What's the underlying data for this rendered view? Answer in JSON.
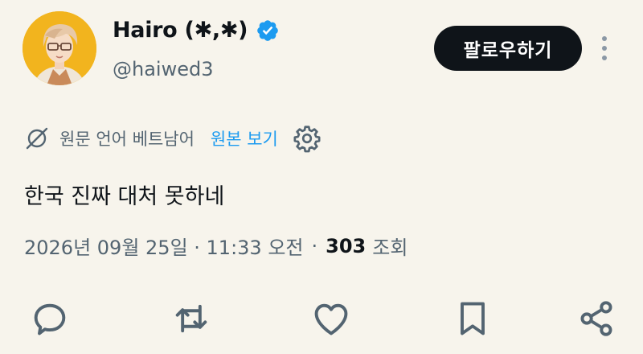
{
  "user": {
    "name": "Hairo (✱,✱)",
    "handle": "@haiwed3"
  },
  "follow_label": "팔로우하기",
  "translation": {
    "source_text": "원문 언어 베트남어",
    "show_original": "원본 보기"
  },
  "tweet": {
    "text": "한국 진짜 대처 못하네",
    "datetime": "2026년 09월 25일 · 11:33 오전",
    "views_count": "303",
    "views_label": "조회"
  },
  "icons": {
    "verified": "verified-badge-icon",
    "more": "more-vertical-icon",
    "translate": "translate-icon",
    "settings": "gear-icon",
    "reply": "reply-icon",
    "retweet": "retweet-icon",
    "like": "heart-icon",
    "bookmark": "bookmark-icon",
    "share": "share-icon"
  },
  "colors": {
    "background": "#f7f4ec",
    "verified": "#1d9bf0",
    "link": "#1d9bf0",
    "button": "#0f1419",
    "secondary_text": "#536471",
    "avatar_bg": "#f2b41e"
  }
}
